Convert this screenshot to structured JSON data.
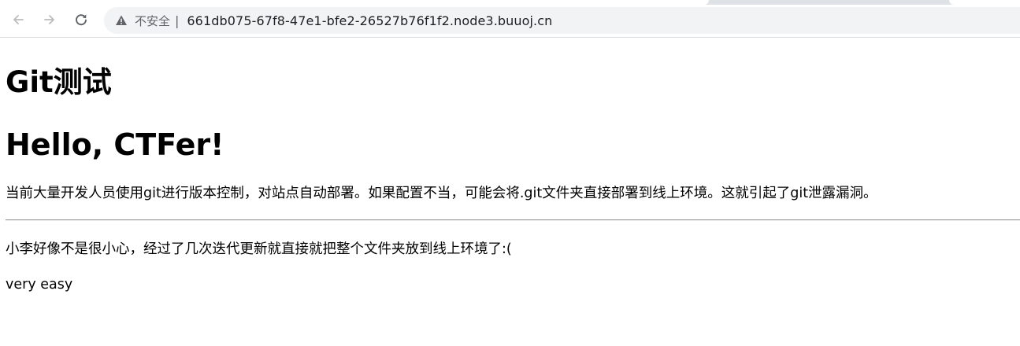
{
  "browser": {
    "security_label": "不安全",
    "separator": "|",
    "url": "661db075-67f8-47e1-bfe2-26527b76f1f2.node3.buuoj.cn",
    "icons": {
      "back": "arrow-left-icon",
      "forward": "arrow-right-icon",
      "reload": "reload-icon",
      "security": "warning-triangle-icon"
    }
  },
  "page": {
    "heading_git": "Git测试",
    "heading_hello": "Hello, CTFer!",
    "intro": "当前大量开发人员使用git进行版本控制，对站点自动部署。如果配置不当，可能会将.git文件夹直接部署到线上环境。这就引起了git泄露漏洞。",
    "xiaoli": "小李好像不是很小心，经过了几次迭代更新就直接就把整个文件夹放到线上环境了:(",
    "footer": "very easy"
  }
}
